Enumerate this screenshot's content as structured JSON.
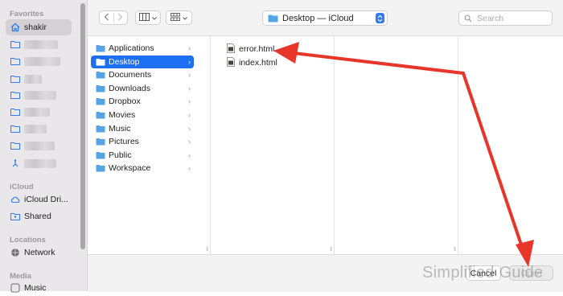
{
  "sidebar": {
    "favorites_heading": "Favorites",
    "home_label": "shakir",
    "icloud_heading": "iCloud",
    "icloud_drive_label": "iCloud Dri...",
    "shared_label": "Shared",
    "locations_heading": "Locations",
    "network_label": "Network",
    "media_heading": "Media",
    "music_label": "Music"
  },
  "toolbar": {
    "back_icon": "chevron-left-icon",
    "forward_icon": "chevron-right-icon",
    "view_icon": "column-view-icon",
    "group_icon": "grid-icon",
    "location_label": "Desktop — iCloud",
    "search_placeholder": "Search"
  },
  "columns": {
    "first": [
      {
        "label": "Applications",
        "selected": false
      },
      {
        "label": "Desktop",
        "selected": true
      },
      {
        "label": "Documents",
        "selected": false
      },
      {
        "label": "Downloads",
        "selected": false
      },
      {
        "label": "Dropbox",
        "selected": false
      },
      {
        "label": "Movies",
        "selected": false
      },
      {
        "label": "Music",
        "selected": false
      },
      {
        "label": "Pictures",
        "selected": false
      },
      {
        "label": "Public",
        "selected": false
      },
      {
        "label": "Workspace",
        "selected": false
      }
    ],
    "files": [
      {
        "label": "error.html"
      },
      {
        "label": "index.html"
      }
    ]
  },
  "footer": {
    "cancel_label": "Cancel",
    "open_label": "Open"
  },
  "watermark": "Simplified Guide",
  "colors": {
    "accent": "#1d6ef0",
    "folder": "#55a4e6",
    "arrow": "#e8352a"
  }
}
